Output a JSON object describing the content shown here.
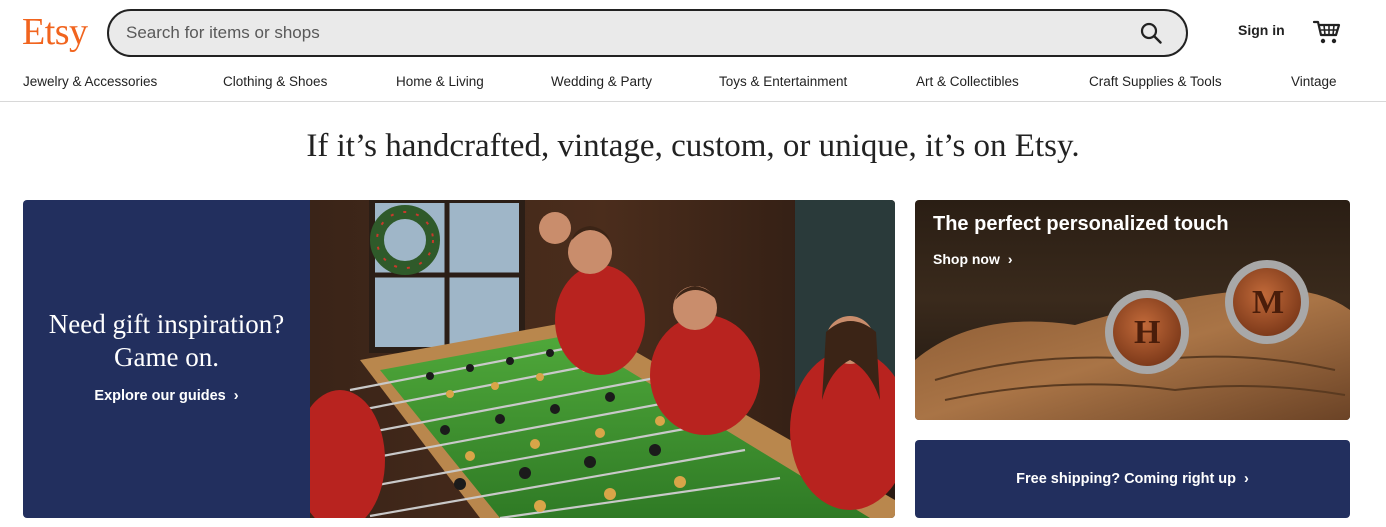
{
  "header": {
    "logo": "Etsy",
    "search_placeholder": "Search for items or shops",
    "sign_in": "Sign in"
  },
  "categories": [
    "Jewelry & Accessories",
    "Clothing & Shoes",
    "Home & Living",
    "Wedding & Party",
    "Toys & Entertainment",
    "Art & Collectibles",
    "Craft Supplies & Tools",
    "Vintage"
  ],
  "tagline": "If it’s handcrafted, vintage, custom, or unique, it’s on Etsy.",
  "hero": {
    "heading_line1": "Need gift inspiration?",
    "heading_line2": "Game on.",
    "link": "Explore our guides",
    "chevron": "›"
  },
  "card_personalized": {
    "title": "The perfect personalized touch",
    "link": "Shop now",
    "chevron": "›",
    "letters": [
      "H",
      "M"
    ]
  },
  "card_shipping": {
    "text": "Free shipping? Coming right up",
    "chevron": "›"
  },
  "colors": {
    "brand": "#F1641E",
    "navy": "#222f5e"
  },
  "icons": {
    "search": "search-icon",
    "cart": "cart-icon",
    "chevron": "chevron-right-icon"
  }
}
